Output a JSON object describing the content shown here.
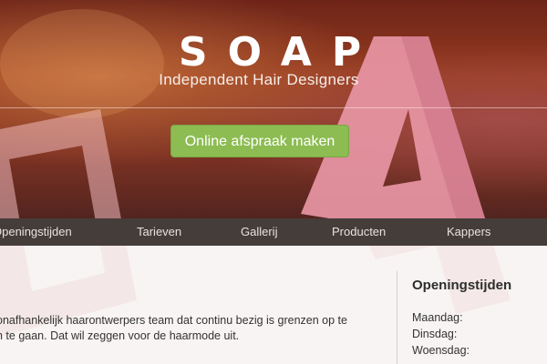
{
  "header": {
    "logo_text": "SOAP",
    "tagline": "Independent Hair Designers",
    "cta_label": "Online afspraak maken"
  },
  "nav": {
    "items": [
      {
        "label": "Openingstijden"
      },
      {
        "label": "Tarieven"
      },
      {
        "label": "Gallerij"
      },
      {
        "label": "Producten"
      },
      {
        "label": "Kappers"
      }
    ]
  },
  "main": {
    "intro_lines": [
      "onafhankelijk haarontwerpers team dat continu bezig is grenzen op te",
      "n te gaan. Dat wil zeggen voor de haarmode uit."
    ]
  },
  "sidebar": {
    "title": "Openingstijden",
    "days": [
      "Maandag:",
      "Dinsdag:",
      "Woensdag:"
    ]
  },
  "colors": {
    "cta": "#8cbc52",
    "nav_bg": "#453d3a",
    "content_bg": "#f8f4f3"
  }
}
